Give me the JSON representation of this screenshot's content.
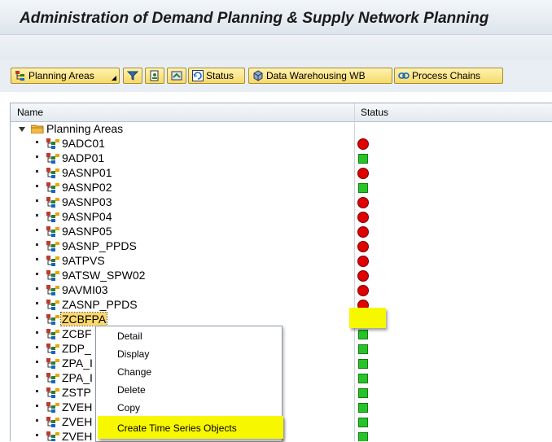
{
  "window": {
    "title": "Administration of Demand Planning & Supply Network Planning"
  },
  "toolbar": {
    "planning_areas_label": "Planning Areas",
    "status_label": "Status",
    "dwb_label": "Data Warehousing WB",
    "process_chains_label": "Process Chains"
  },
  "tree": {
    "col_name": "Name",
    "col_status": "Status",
    "root_label": "Planning Areas",
    "items": [
      {
        "label": "9ADC01",
        "status": "red"
      },
      {
        "label": "9ADP01",
        "status": "green"
      },
      {
        "label": "9ASNP01",
        "status": "red"
      },
      {
        "label": "9ASNP02",
        "status": "green"
      },
      {
        "label": "9ASNP03",
        "status": "red"
      },
      {
        "label": "9ASNP04",
        "status": "red"
      },
      {
        "label": "9ASNP05",
        "status": "red"
      },
      {
        "label": "9ASNP_PPDS",
        "status": "red"
      },
      {
        "label": "9ATPVS",
        "status": "red"
      },
      {
        "label": "9ATSW_SPW02",
        "status": "red"
      },
      {
        "label": "9AVMI03",
        "status": "red"
      },
      {
        "label": "ZASNP_PPDS",
        "status": "red"
      },
      {
        "label": "ZCBFPA",
        "status": "red",
        "selected": true
      },
      {
        "label": "ZCBF",
        "status": "green"
      },
      {
        "label": "ZDP_",
        "status": "green"
      },
      {
        "label": "ZPA_I",
        "status": "green"
      },
      {
        "label": "ZPA_I",
        "status": "green"
      },
      {
        "label": "ZSTP",
        "status": "green"
      },
      {
        "label": "ZVEH",
        "status": "green"
      },
      {
        "label": "ZVEH",
        "status": "green"
      },
      {
        "label": "ZVEH",
        "status": "green"
      }
    ]
  },
  "context_menu": {
    "items": [
      "Detail",
      "Display",
      "Change",
      "Delete",
      "Copy",
      "Create Time Series Objects"
    ]
  },
  "colors": {
    "status_red": "#e00000",
    "status_green": "#27c427",
    "highlight": "#f7f700",
    "button": "#f5d96a"
  }
}
